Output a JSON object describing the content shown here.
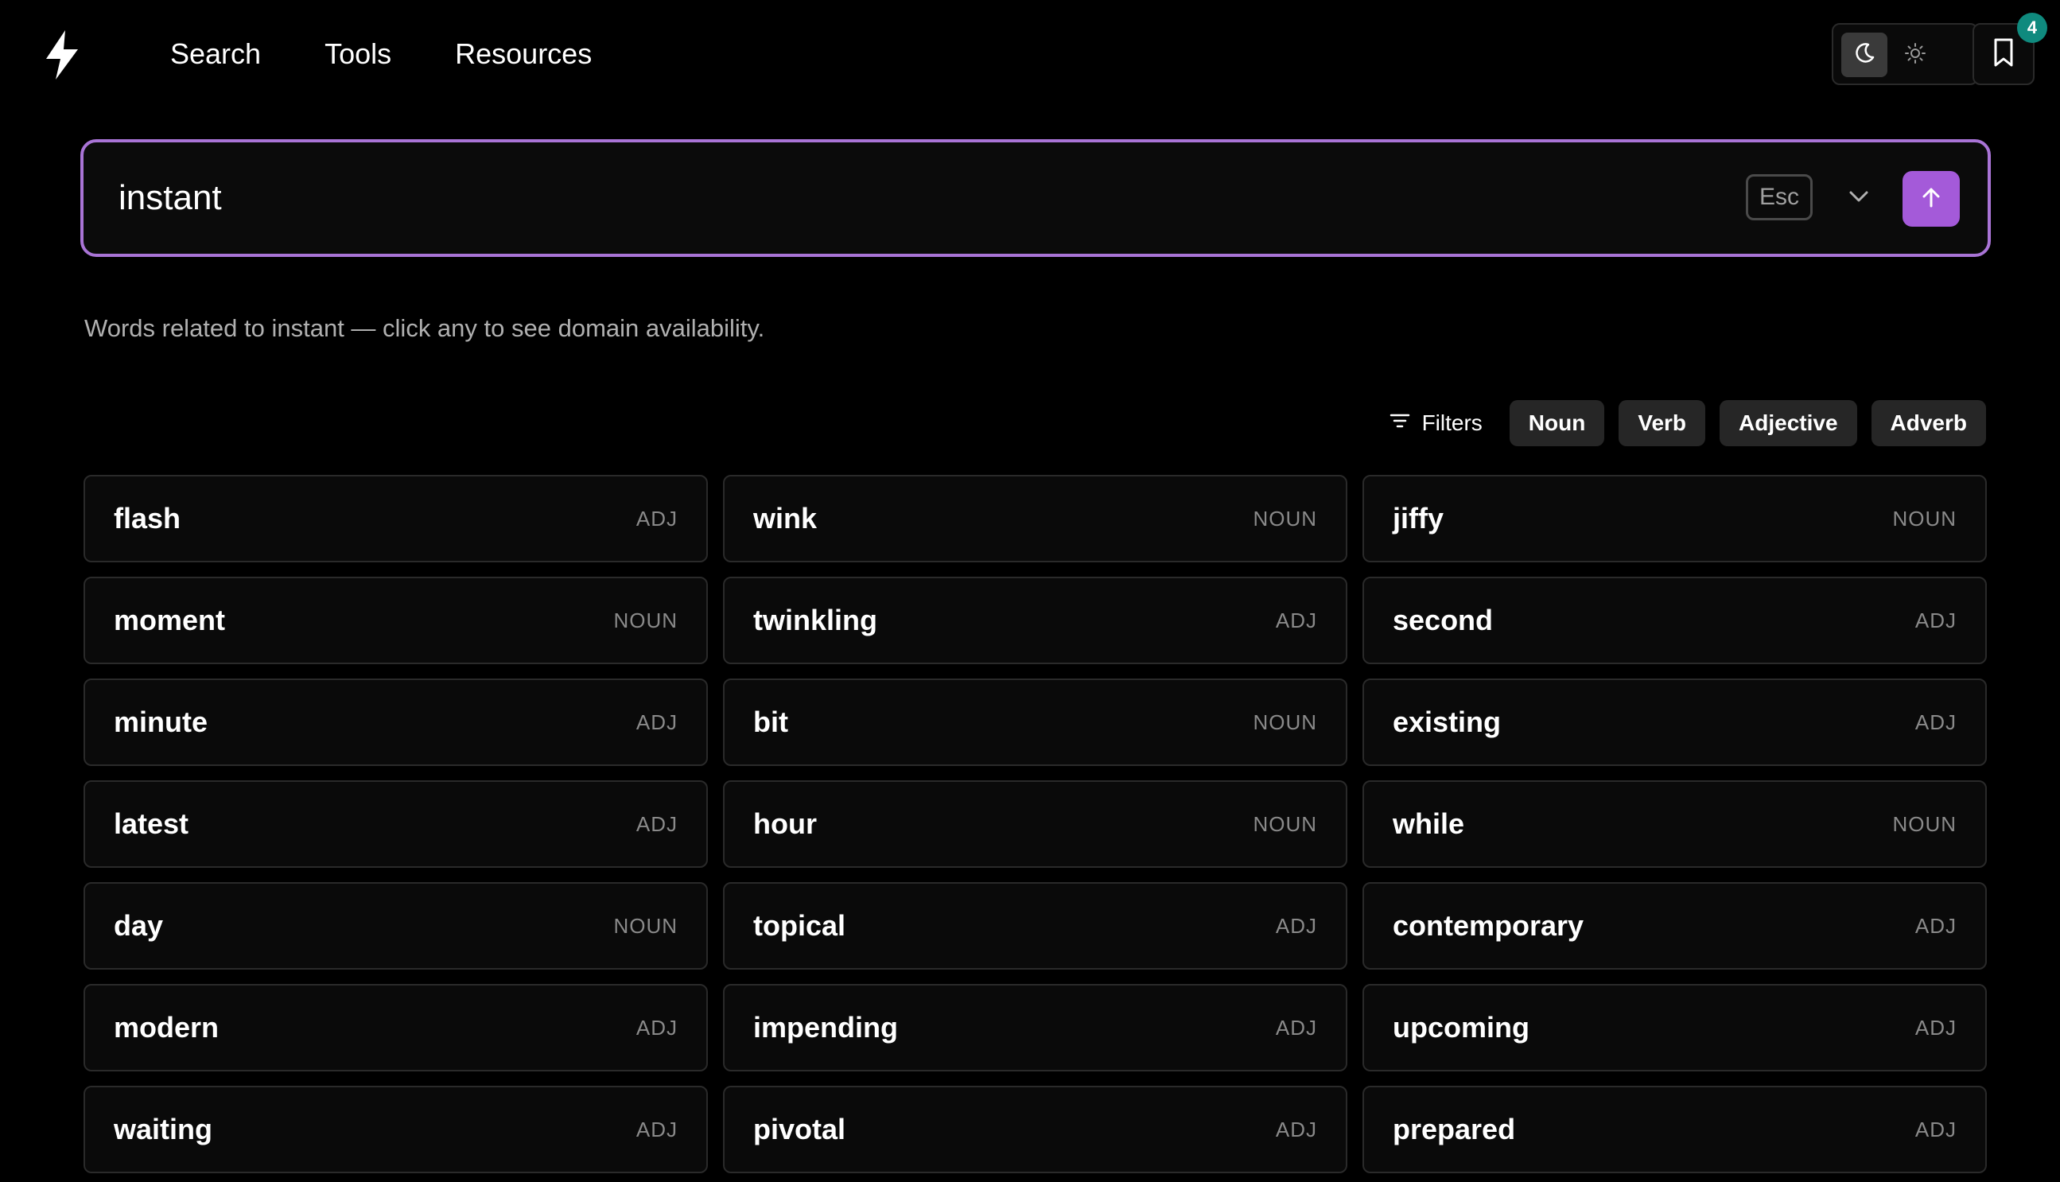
{
  "nav": {
    "items": [
      {
        "label": "Search"
      },
      {
        "label": "Tools"
      },
      {
        "label": "Resources"
      }
    ]
  },
  "bookmarks": {
    "count": "4"
  },
  "search": {
    "value": "instant",
    "esc_label": "Esc"
  },
  "description": "Words related to instant — click any to see domain availability.",
  "filters": {
    "label": "Filters",
    "chips": [
      {
        "label": "Noun"
      },
      {
        "label": "Verb"
      },
      {
        "label": "Adjective"
      },
      {
        "label": "Adverb"
      }
    ]
  },
  "words": [
    {
      "word": "flash",
      "pos": "ADJ"
    },
    {
      "word": "wink",
      "pos": "NOUN"
    },
    {
      "word": "jiffy",
      "pos": "NOUN"
    },
    {
      "word": "moment",
      "pos": "NOUN"
    },
    {
      "word": "twinkling",
      "pos": "ADJ"
    },
    {
      "word": "second",
      "pos": "ADJ"
    },
    {
      "word": "minute",
      "pos": "ADJ"
    },
    {
      "word": "bit",
      "pos": "NOUN"
    },
    {
      "word": "existing",
      "pos": "ADJ"
    },
    {
      "word": "latest",
      "pos": "ADJ"
    },
    {
      "word": "hour",
      "pos": "NOUN"
    },
    {
      "word": "while",
      "pos": "NOUN"
    },
    {
      "word": "day",
      "pos": "NOUN"
    },
    {
      "word": "topical",
      "pos": "ADJ"
    },
    {
      "word": "contemporary",
      "pos": "ADJ"
    },
    {
      "word": "modern",
      "pos": "ADJ"
    },
    {
      "word": "impending",
      "pos": "ADJ"
    },
    {
      "word": "upcoming",
      "pos": "ADJ"
    },
    {
      "word": "waiting",
      "pos": "ADJ"
    },
    {
      "word": "pivotal",
      "pos": "ADJ"
    },
    {
      "word": "prepared",
      "pos": "ADJ"
    }
  ],
  "colors": {
    "background": "#000000",
    "accent": "#a45ad9",
    "accent_border": "#a974d6",
    "badge": "#0f8a7e"
  },
  "icons": {
    "logo": "lightning-bolt-icon",
    "theme_dark": "moon-icon",
    "theme_light": "sun-icon",
    "bookmark": "bookmark-icon",
    "chevron": "chevron-down-icon",
    "submit": "arrow-up-icon",
    "filters": "filter-lines-icon"
  }
}
